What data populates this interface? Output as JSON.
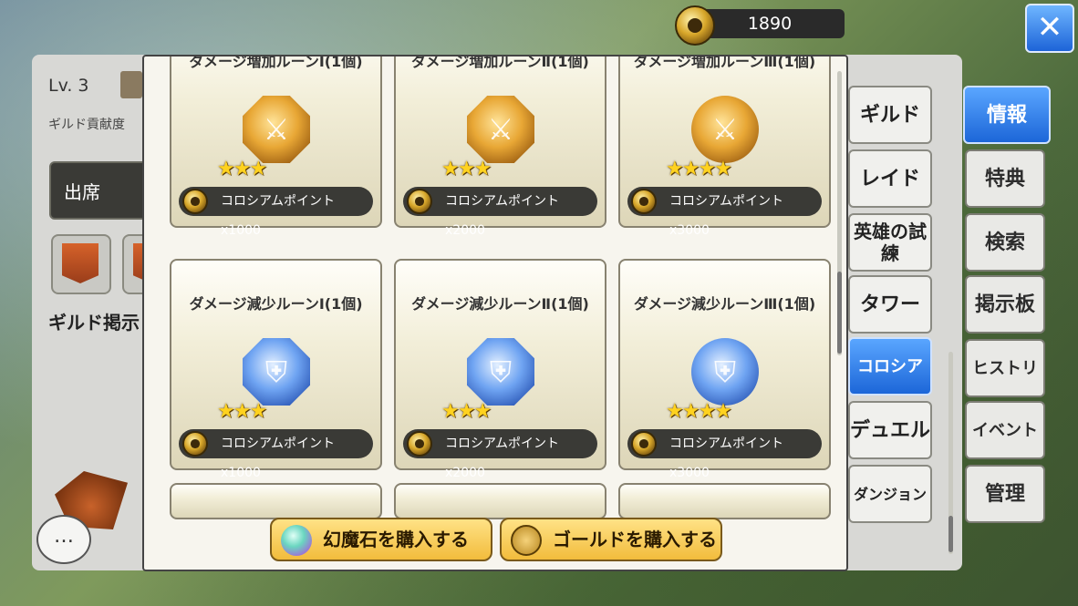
{
  "currency": {
    "amount": "1890",
    "icon": "medal-coin-icon"
  },
  "close_label": "✕",
  "guild": {
    "level": "Lv. 3",
    "contribution_label": "ギルド貢献度",
    "attend_label": "出席",
    "board_label": "ギルド掲示"
  },
  "chat_label": "…",
  "right_tabs": [
    "情報",
    "特典",
    "検索",
    "掲示板",
    "ヒストリー",
    "イベント",
    "管理"
  ],
  "middle_tabs": [
    "ギルド",
    "レイド",
    "英雄の試練",
    "タワー",
    "コロシアム",
    "デュエル",
    "ダンジョン"
  ],
  "active_middle_tab": "コロシアム",
  "active_right_tab": "情報",
  "shop_items": [
    {
      "name": "ダメージ増加ルーンⅠ(1個)",
      "stars": "★★★",
      "cost": "コロシアムポイントx1000",
      "rune": "gold-octagon-rune-icon"
    },
    {
      "name": "ダメージ増加ルーンⅡ(1個)",
      "stars": "★★★",
      "cost": "コロシアムポイントx2000",
      "rune": "gold-octagon-rune-icon"
    },
    {
      "name": "ダメージ増加ルーンⅢ(1個)",
      "stars": "★★★★",
      "cost": "コロシアムポイントx3000",
      "rune": "gold-round-rune-icon"
    },
    {
      "name": "ダメージ減少ルーンⅠ(1個)",
      "stars": "★★★",
      "cost": "コロシアムポイントx1000",
      "rune": "blue-octagon-rune-icon"
    },
    {
      "name": "ダメージ減少ルーンⅡ(1個)",
      "stars": "★★★",
      "cost": "コロシアムポイントx2000",
      "rune": "blue-octagon-rune-icon"
    },
    {
      "name": "ダメージ減少ルーンⅢ(1個)",
      "stars": "★★★★",
      "cost": "コロシアムポイントx3000",
      "rune": "blue-round-rune-icon"
    }
  ],
  "buttons": {
    "buy_gems": "幻魔石を購入する",
    "buy_gold": "ゴールドを購入する"
  }
}
